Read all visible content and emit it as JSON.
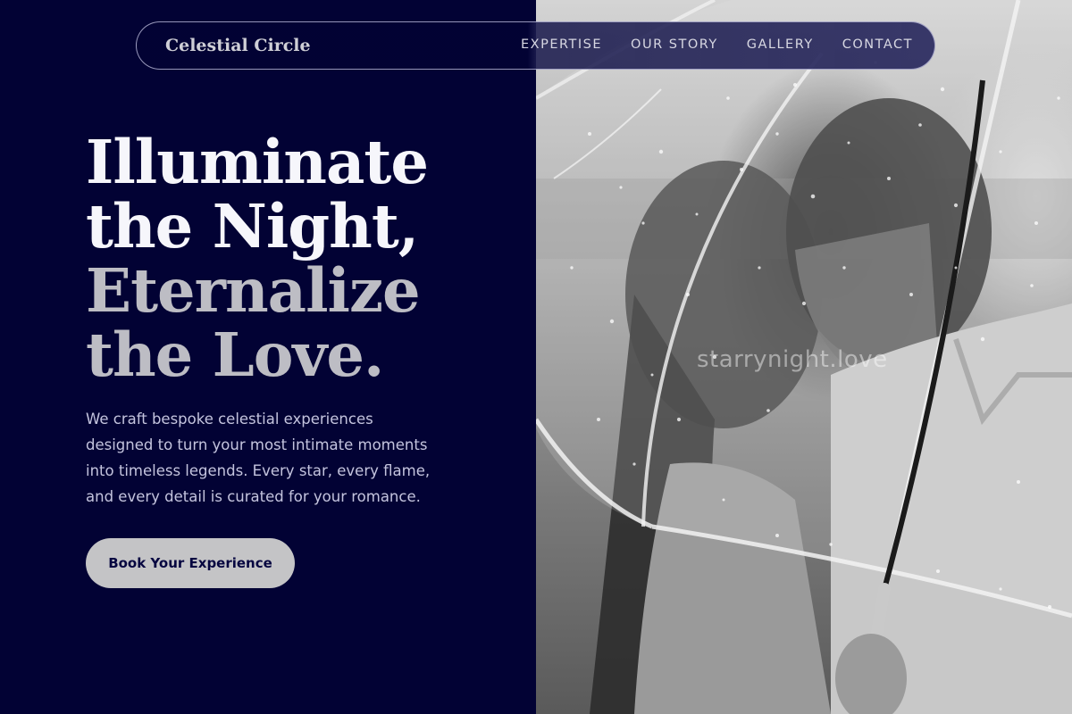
{
  "brand": {
    "name": "Celestial Circle"
  },
  "nav": {
    "items": [
      {
        "label": "EXPERTISE"
      },
      {
        "label": "OUR STORY"
      },
      {
        "label": "GALLERY"
      },
      {
        "label": "CONTACT"
      }
    ]
  },
  "hero": {
    "title_lines": [
      "Illuminate",
      "the Night,",
      "Eternalize",
      "the Love."
    ],
    "description": "We craft bespoke celestial experiences designed to turn your most intimate moments into timeless legends. Every star, every flame, and every detail is curated for your romance.",
    "cta_label": "Book Your Experience"
  },
  "photo": {
    "alt": "Couple embracing under a clear umbrella in the rain",
    "watermark": "starrynight.love"
  },
  "colors": {
    "background": "#020234",
    "title_primary": "#f6f6fb",
    "title_secondary": "#bdbdc4",
    "button_background": "#c4c4c6",
    "button_text": "#060640"
  }
}
